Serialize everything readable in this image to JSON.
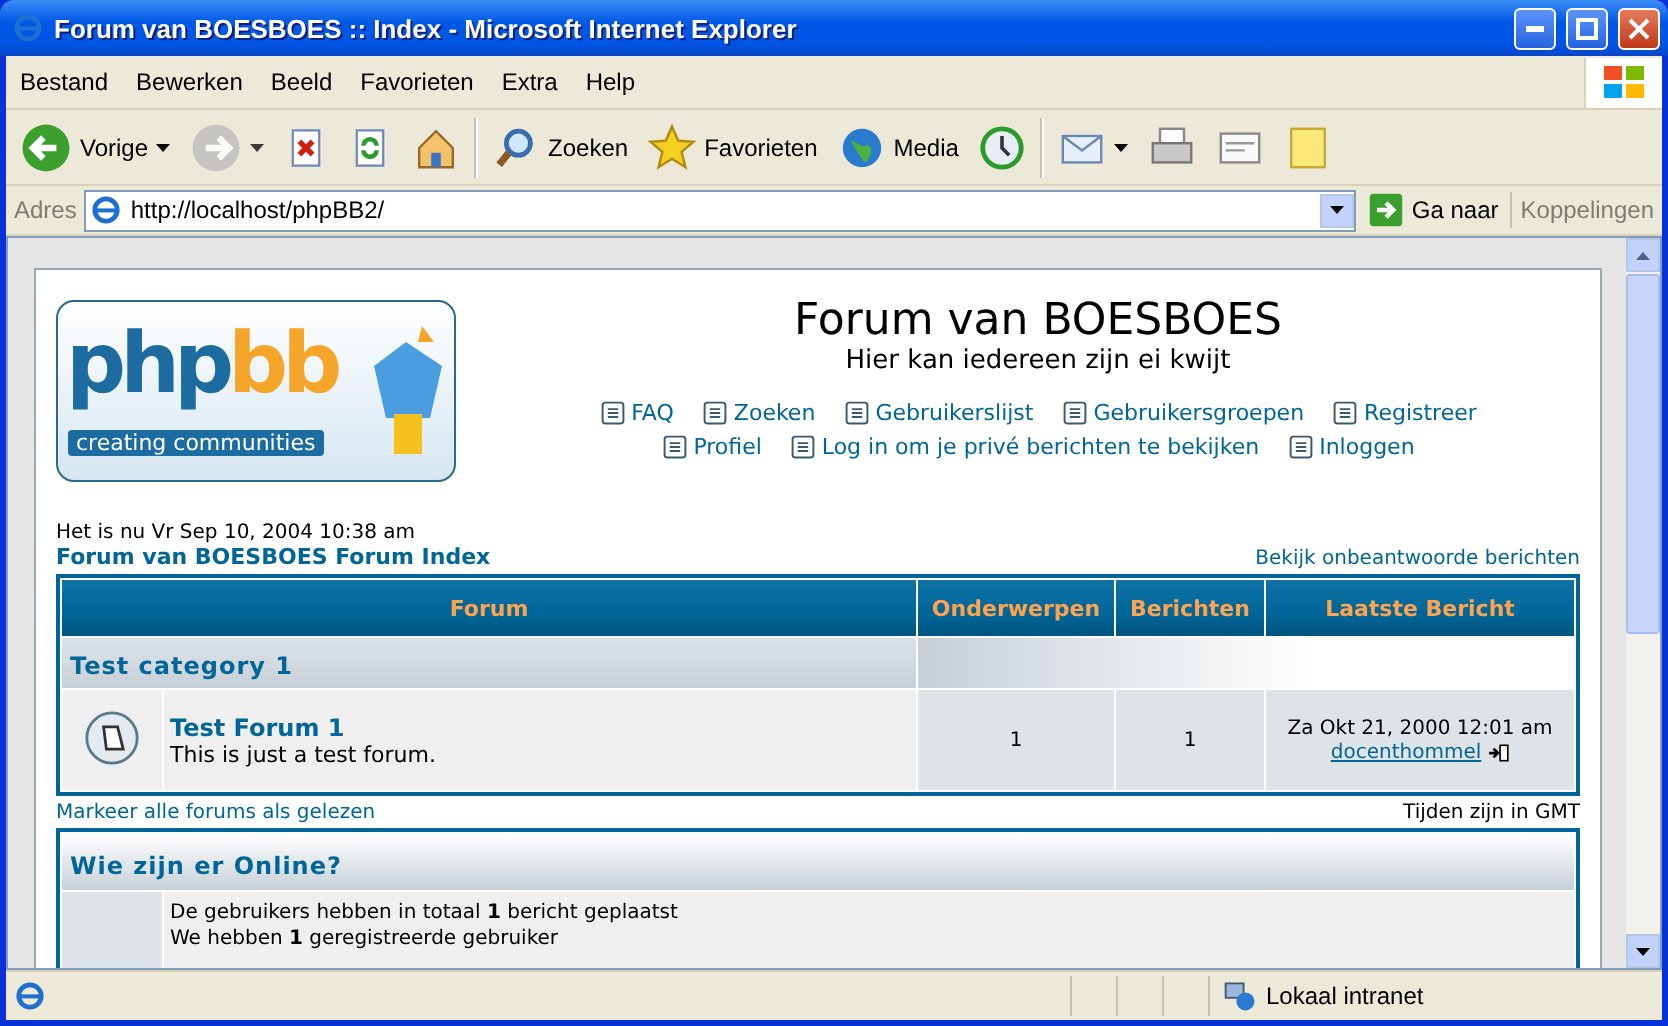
{
  "window": {
    "title": "Forum van BOESBOES :: Index - Microsoft Internet Explorer"
  },
  "menu": [
    "Bestand",
    "Bewerken",
    "Beeld",
    "Favorieten",
    "Extra",
    "Help"
  ],
  "toolbar": [
    {
      "kind": "split",
      "label": "Vorige"
    },
    {
      "kind": "split-disabled"
    },
    {
      "kind": "plain"
    },
    {
      "kind": "plain"
    },
    {
      "kind": "plain"
    },
    {
      "kind": "separator"
    },
    {
      "kind": "plain",
      "label": "Zoeken"
    },
    {
      "kind": "plain",
      "label": "Favorieten"
    },
    {
      "kind": "plain",
      "label": "Media"
    },
    {
      "kind": "plain"
    },
    {
      "kind": "separator"
    },
    {
      "kind": "split"
    },
    {
      "kind": "plain"
    },
    {
      "kind": "plain"
    },
    {
      "kind": "plain"
    }
  ],
  "address": {
    "label": "Adres",
    "url": "http://localhost/phpBB2/",
    "go": "Ga naar",
    "links": "Koppelingen"
  },
  "page": {
    "logo": {
      "php": "php",
      "bb": "bb",
      "tagline": "creating communities"
    },
    "site_title": "Forum van BOESBOES",
    "site_description": "Hier kan iedereen zijn ei kwijt",
    "nav_rows": [
      [
        "FAQ",
        "Zoeken",
        "Gebruikerslijst",
        "Gebruikersgroepen",
        "Registreer"
      ],
      [
        "Profiel",
        "Log in om je privé berichten te bekijken",
        "Inloggen"
      ]
    ],
    "datetime": "Het is nu Vr Sep 10, 2004 10:38 am",
    "breadcrumb": "Forum van BOESBOES Forum Index",
    "unanswered": "Bekijk onbeantwoorde berichten",
    "table": {
      "columns": [
        "Forum",
        "Onderwerpen",
        "Berichten",
        "Laatste Bericht"
      ],
      "categories": [
        {
          "name": "Test category 1",
          "forums": [
            {
              "name": "Test Forum 1",
              "description": "This is just a test forum.",
              "topics": "1",
              "posts": "1",
              "last_post_date": "Za Okt 21, 2000 12:01 am",
              "last_post_user": "docenthommel"
            }
          ]
        }
      ]
    },
    "mark_read": "Markeer alle forums als gelezen",
    "timezone": "Tijden zijn in GMT",
    "online": {
      "title": "Wie zijn er Online?",
      "lines": [
        "De gebruikers hebben in totaal **1** bericht geplaatst",
        "We hebben **1** geregistreerde gebruiker"
      ]
    }
  },
  "status_bar": {
    "zone": "Lokaal intranet"
  }
}
